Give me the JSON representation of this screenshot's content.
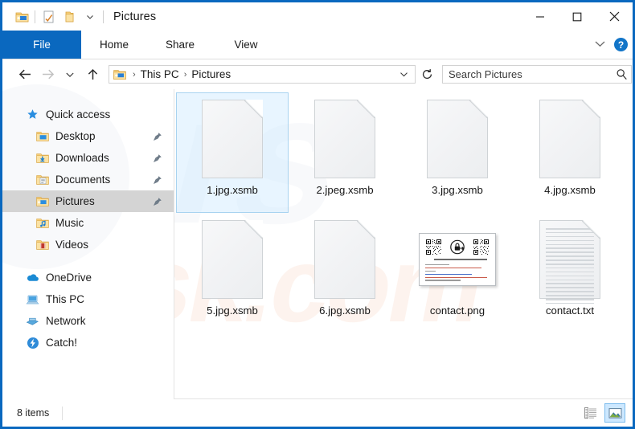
{
  "window": {
    "title": "Pictures",
    "accent_color": "#0a68bf",
    "border_color": "#0a68bf"
  },
  "quick_access_toolbar": {
    "explorer_icon": "folder-explorer-icon",
    "properties_icon": "properties-checkmark-icon",
    "new_folder_icon": "new-folder-icon",
    "dropdown_icon": "chevron-down-icon"
  },
  "window_controls": {
    "minimize": "–",
    "maximize": "□",
    "close": "✕"
  },
  "ribbon": {
    "tabs": [
      {
        "label": "File",
        "active": true
      },
      {
        "label": "Home",
        "active": false
      },
      {
        "label": "Share",
        "active": false
      },
      {
        "label": "View",
        "active": false
      }
    ],
    "collapse_icon": "chevron-down-icon",
    "help_label": "?"
  },
  "navigation": {
    "back_icon": "arrow-left-icon",
    "forward_icon": "arrow-right-icon",
    "recent_icon": "chevron-down-icon",
    "up_icon": "arrow-up-icon",
    "address_icon": "pictures-folder-icon",
    "breadcrumbs": [
      "This PC",
      "Pictures"
    ],
    "separator": "›",
    "address_dropdown_icon": "chevron-down-icon",
    "refresh_icon": "refresh-icon"
  },
  "search": {
    "placeholder": "Search Pictures",
    "value": "",
    "icon": "search-icon"
  },
  "sidebar": {
    "items": [
      {
        "label": "Quick access",
        "icon": "star-pin-icon",
        "level": "root",
        "pinned": false,
        "selected": false
      },
      {
        "label": "Desktop",
        "icon": "desktop-folder-icon",
        "level": "child",
        "pinned": true,
        "selected": false
      },
      {
        "label": "Downloads",
        "icon": "downloads-folder-icon",
        "level": "child",
        "pinned": true,
        "selected": false
      },
      {
        "label": "Documents",
        "icon": "documents-folder-icon",
        "level": "child",
        "pinned": true,
        "selected": false
      },
      {
        "label": "Pictures",
        "icon": "pictures-folder-icon",
        "level": "child",
        "pinned": true,
        "selected": true
      },
      {
        "label": "Music",
        "icon": "music-folder-icon",
        "level": "child",
        "pinned": false,
        "selected": false
      },
      {
        "label": "Videos",
        "icon": "videos-folder-icon",
        "level": "child",
        "pinned": false,
        "selected": false
      },
      {
        "label": "OneDrive",
        "icon": "onedrive-cloud-icon",
        "level": "root",
        "pinned": false,
        "selected": false
      },
      {
        "label": "This PC",
        "icon": "this-pc-icon",
        "level": "root",
        "pinned": false,
        "selected": false
      },
      {
        "label": "Network",
        "icon": "network-icon",
        "level": "root",
        "pinned": false,
        "selected": false
      },
      {
        "label": "Catch!",
        "icon": "catch-app-icon",
        "level": "root",
        "pinned": false,
        "selected": false
      }
    ]
  },
  "files": [
    {
      "name": "1.jpg.xsmb",
      "kind": "blank-doc",
      "selected": true
    },
    {
      "name": "2.jpeg.xsmb",
      "kind": "blank-doc",
      "selected": false
    },
    {
      "name": "3.jpg.xsmb",
      "kind": "blank-doc",
      "selected": false
    },
    {
      "name": "4.jpg.xsmb",
      "kind": "blank-doc",
      "selected": false
    },
    {
      "name": "5.jpg.xsmb",
      "kind": "blank-doc",
      "selected": false
    },
    {
      "name": "6.jpg.xsmb",
      "kind": "blank-doc",
      "selected": false
    },
    {
      "name": "contact.png",
      "kind": "ransom-note-image",
      "selected": false
    },
    {
      "name": "contact.txt",
      "kind": "text-doc",
      "selected": false
    }
  ],
  "statusbar": {
    "item_count": "8 items",
    "details_view_icon": "details-view-icon",
    "large_icons_view_icon": "large-icons-view-icon",
    "active_view": "large-icons-view-icon"
  },
  "watermark": {
    "text": "risk.com",
    "color": "#e9783c"
  }
}
